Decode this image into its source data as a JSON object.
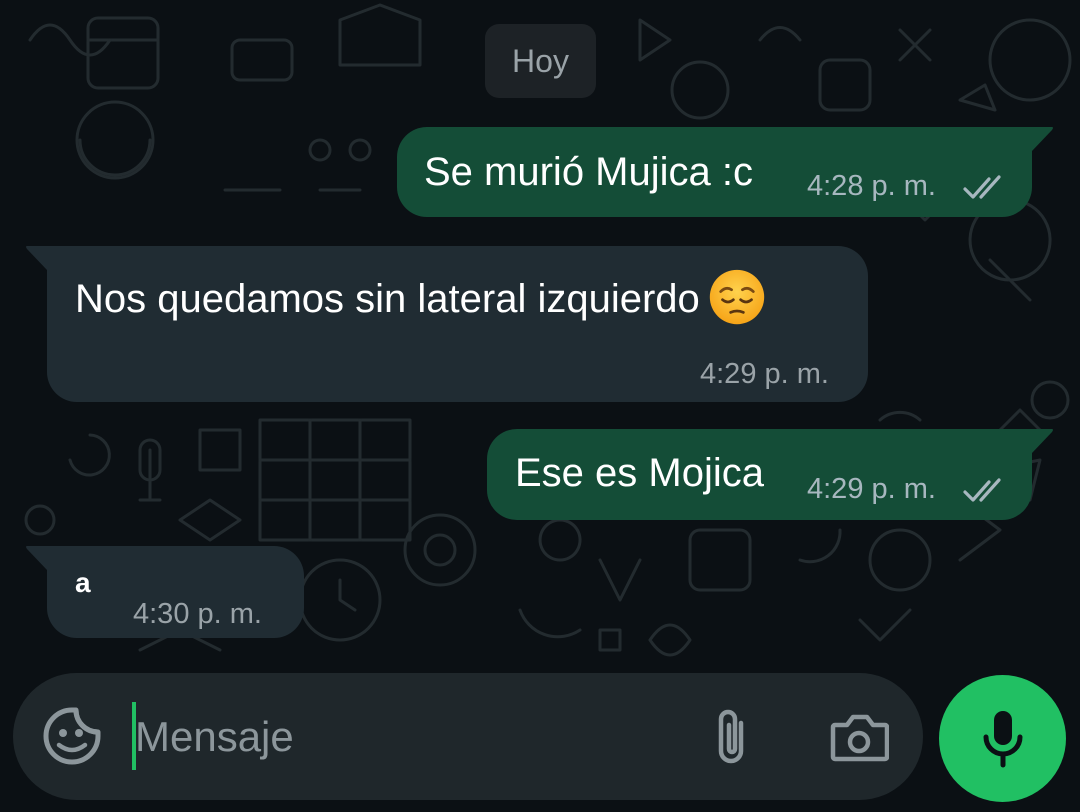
{
  "chat": {
    "day_separator": "Hoy",
    "messages": [
      {
        "direction": "outgoing",
        "text": "Se murió Mujica :c",
        "time": "4:28 p. m.",
        "status": "read"
      },
      {
        "direction": "incoming",
        "text": "Nos quedamos sin lateral izquierdo",
        "emoji": "pensive-face",
        "time": "4:29 p. m."
      },
      {
        "direction": "outgoing",
        "text": "Ese es Mojica",
        "time": "4:29 p. m.",
        "status": "read"
      },
      {
        "direction": "incoming",
        "text": "a",
        "time": "4:30 p. m."
      }
    ]
  },
  "composer": {
    "placeholder": "Mensaje",
    "icons": [
      "sticker-icon",
      "paperclip-icon",
      "camera-icon",
      "microphone-icon"
    ]
  },
  "colors": {
    "background": "#0b1014",
    "outgoing_bubble": "#144d37",
    "incoming_bubble": "#202c33",
    "accent": "#21c063",
    "read_ticks": "#a7b7bf"
  }
}
